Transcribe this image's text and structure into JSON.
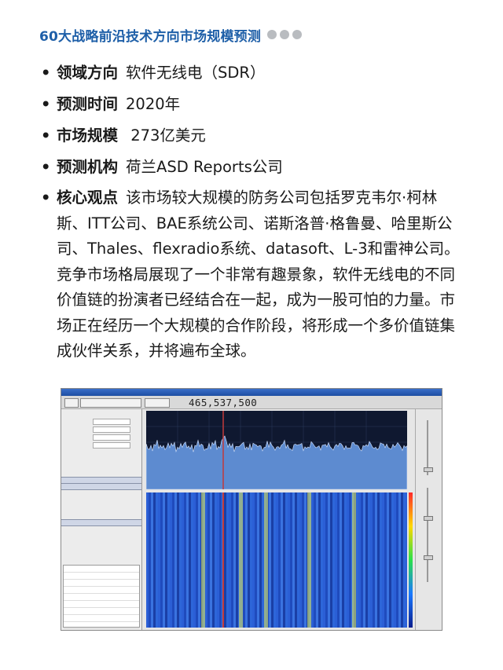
{
  "header": {
    "title": "60大战略前沿技术方向市场规模预测"
  },
  "items": [
    {
      "key": "领域方向",
      "value": "软件无线电（SDR）"
    },
    {
      "key": "预测时间",
      "value": "2020年"
    },
    {
      "key": "市场规模",
      "value": " 273亿美元"
    },
    {
      "key": "预测机构",
      "value": "荷兰ASD Reports公司"
    },
    {
      "key": "核心观点",
      "value": "该市场较大规模的防务公司包括罗克韦尔·柯林斯、ITT公司、BAE系统公司、诺斯洛普·格鲁曼、哈里斯公司、Thales、flexradio系统、datasoft、L-3和雷神公司。竞争市场格局展现了一个非常有趣景象，软件无线电的不同价值链的扮演者已经结合在一起，成为一股可怕的力量。市场正在经历一个大规模的合作阶段，将形成一个多价值链集成伙伴关系，并将遍布全球。"
    }
  ],
  "sdr_screenshot": {
    "frequency_display": "465,537,500",
    "colors": {
      "titlebar": "#1d4ea3",
      "spectrum_fill": "#5d8bd0",
      "waterfall_base": "#1c46c2",
      "header_blue": "#1e5fa8"
    }
  }
}
